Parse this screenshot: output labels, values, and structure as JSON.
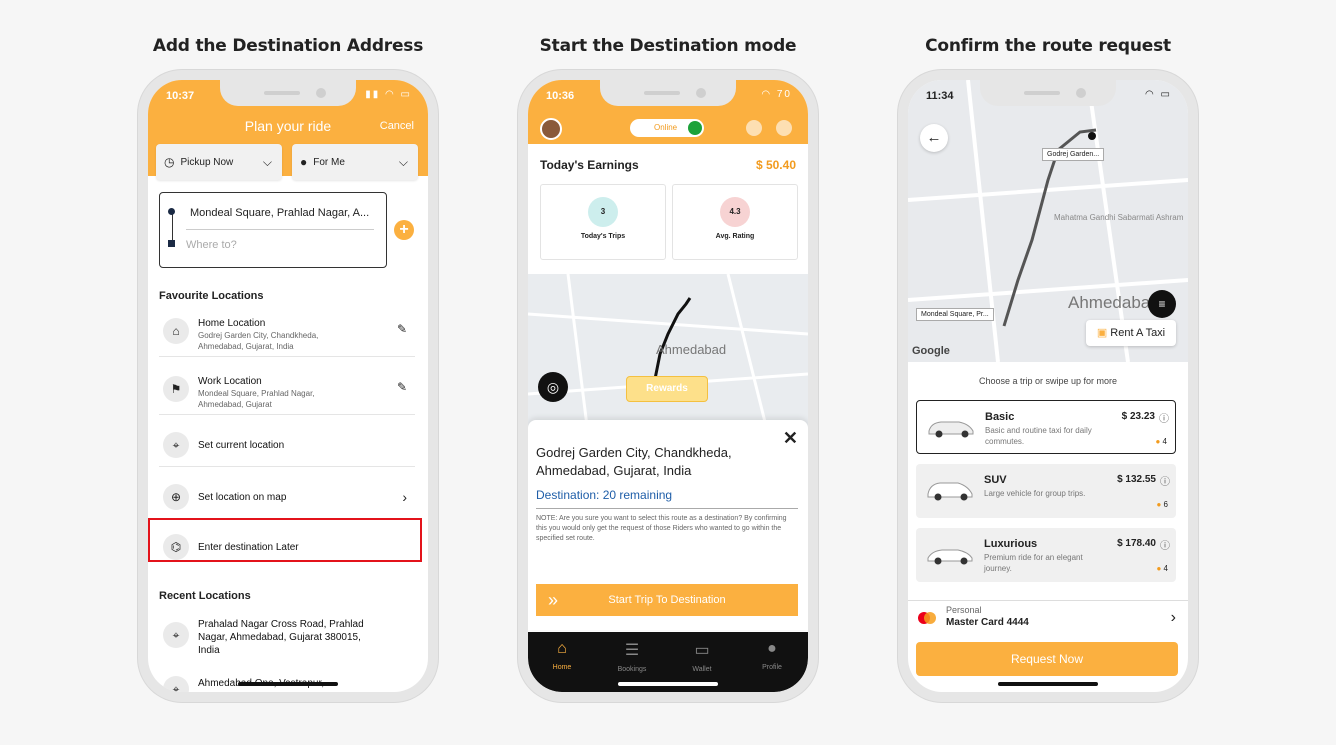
{
  "headings": [
    "Add the Destination Address",
    "Start the Destination mode",
    "Confirm the route request"
  ],
  "phone1": {
    "time": "10:37",
    "title": "Plan your ride",
    "cancel": "Cancel",
    "pickup": "Pickup Now",
    "forme": "For Me",
    "address": "Mondeal Square, Prahlad Nagar, A...",
    "where_placeholder": "Where to?",
    "fav_title": "Favourite Locations",
    "home_title": "Home Location",
    "home_sub": "Godrej Garden City, Chandkheda, Ahmedabad, Gujarat, India",
    "work_title": "Work Location",
    "work_sub": "Mondeal Square, Prahlad Nagar, Ahmedabad, Gujarat",
    "set_current": "Set current location",
    "set_map": "Set location on map",
    "enter_later": "Enter destination Later",
    "recent_title": "Recent Locations",
    "recent1": "Prahalad Nagar Cross Road, Prahlad Nagar, Ahmedabad, Gujarat 380015, India",
    "recent2": "Ahmedabad One, Vastrapur,"
  },
  "phone2": {
    "time": "10:36",
    "battery": "70",
    "online": "Online",
    "earnings_label": "Today's Earnings",
    "earnings_value": "$ 50.40",
    "trips_value": "3",
    "trips_label": "Today's Trips",
    "rating_value": "4.3",
    "rating_label": "Avg. Rating",
    "map_city": "Ahmedabad",
    "rewards": "Rewards",
    "dest_address": "Godrej Garden City, Chandkheda, Ahmedabad, Gujarat, India",
    "dest_remaining": "Destination: 20 remaining",
    "note": "NOTE: Are you sure you want to select this route as a destination? By confirming this you would only get the request of those Riders who wanted to go within the specified set route.",
    "start_btn": "Start Trip To Destination",
    "tabs": [
      "Home",
      "Bookings",
      "Wallet",
      "Profile"
    ]
  },
  "phone3": {
    "time": "11:34",
    "tag_top": "Godrej Garden...",
    "tag_bottom": "Mondeal Square, Pr...",
    "map_city": "Ahmedabad",
    "map_area": "Mahatma Gandhi Sabarmati Ashram",
    "google": "Google",
    "rent": "Rent A Taxi",
    "choose": "Choose a trip or swipe up for more",
    "rides": [
      {
        "name": "Basic",
        "desc": "Basic and routine taxi for daily commutes.",
        "price": "$ 23.23",
        "seats": "4"
      },
      {
        "name": "SUV",
        "desc": "Large vehicle for group trips.",
        "price": "$ 132.55",
        "seats": "6"
      },
      {
        "name": "Luxurious",
        "desc": "Premium ride for an elegant journey.",
        "price": "$ 178.40",
        "seats": "4"
      }
    ],
    "pay_type": "Personal",
    "pay_card": "Master Card 4444",
    "request": "Request Now"
  }
}
